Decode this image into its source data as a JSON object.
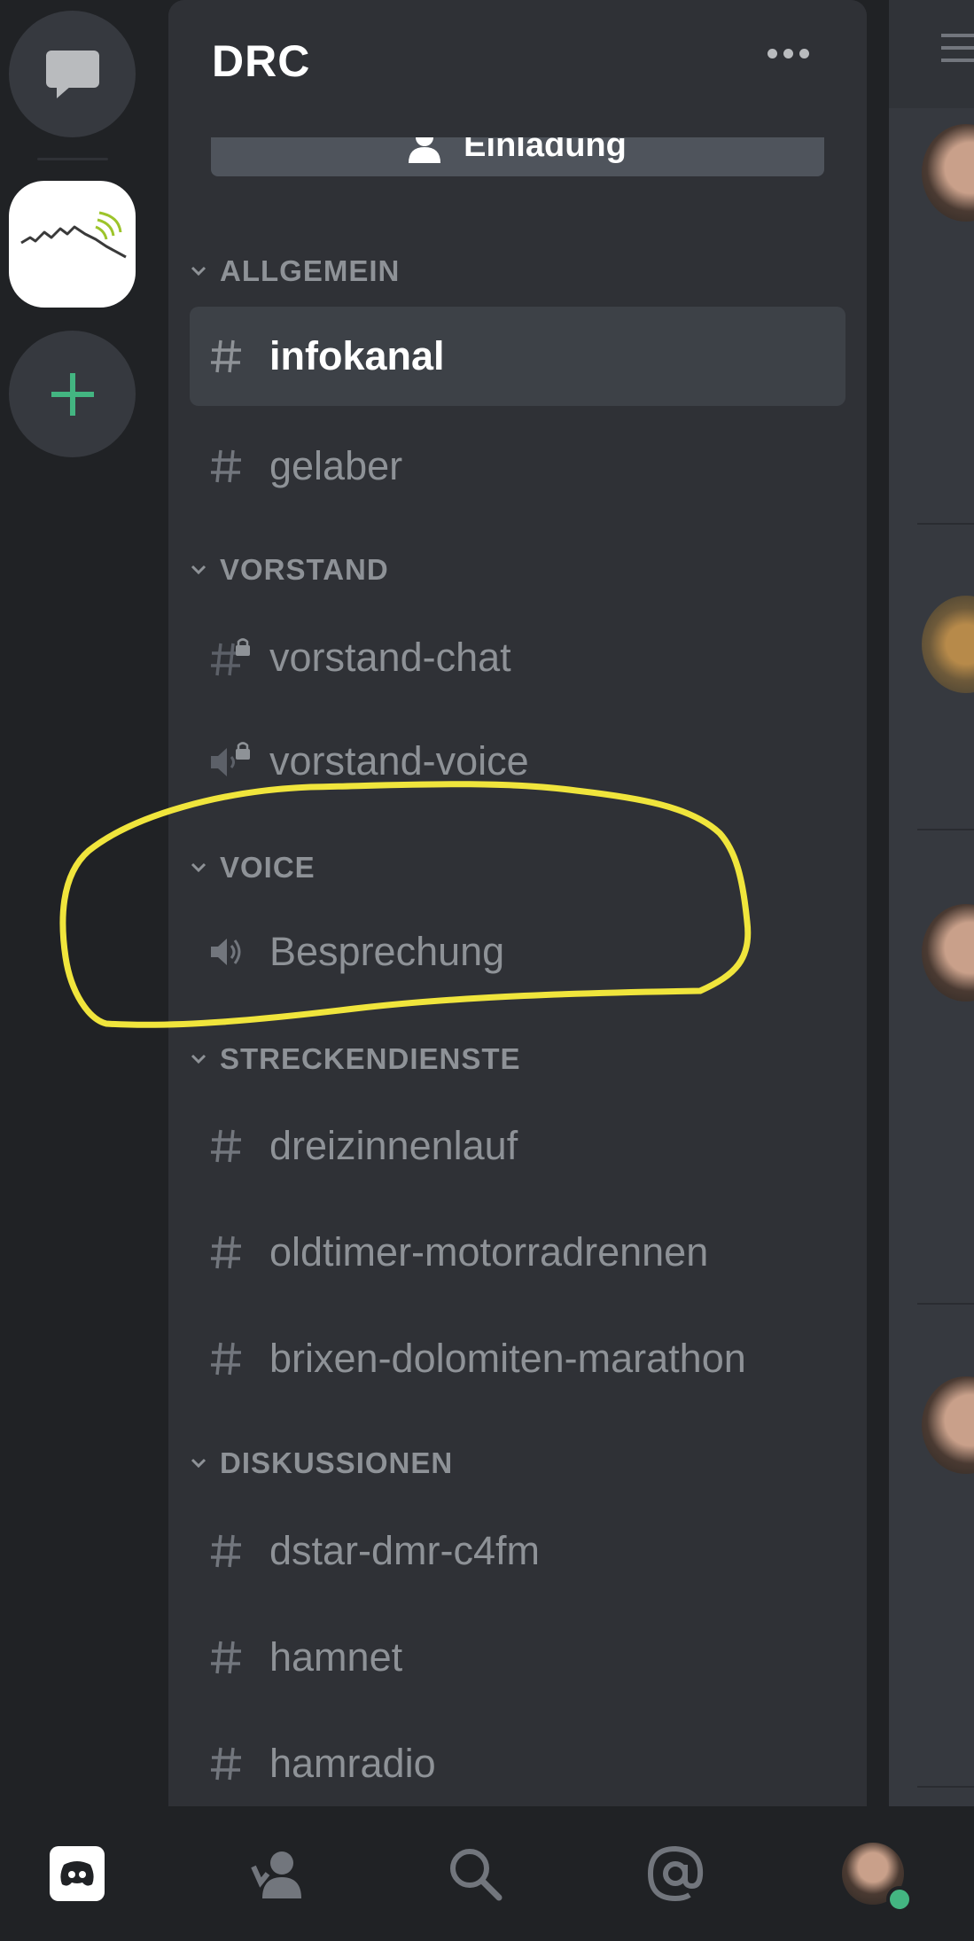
{
  "server": {
    "name": "DRC",
    "invite_label": "Einladung"
  },
  "categories": [
    {
      "label": "ALLGEMEIN"
    },
    {
      "label": "VORSTAND"
    },
    {
      "label": "VOICE"
    },
    {
      "label": "STRECKENDIENSTE"
    },
    {
      "label": "DISKUSSIONEN"
    }
  ],
  "channels": [
    {
      "label": "infokanal",
      "type": "text",
      "selected": true
    },
    {
      "label": "gelaber",
      "type": "text"
    },
    {
      "label": "vorstand-chat",
      "type": "text-locked"
    },
    {
      "label": "vorstand-voice",
      "type": "voice-locked"
    },
    {
      "label": "Besprechung",
      "type": "voice"
    },
    {
      "label": "dreizinnenlauf",
      "type": "text"
    },
    {
      "label": "oldtimer-motorradrennen",
      "type": "text"
    },
    {
      "label": "brixen-dolomiten-marathon",
      "type": "text"
    },
    {
      "label": "dstar-dmr-c4fm",
      "type": "text"
    },
    {
      "label": "hamnet",
      "type": "text"
    },
    {
      "label": "hamradio",
      "type": "text"
    }
  ],
  "rail": [
    "direct-messages-icon",
    "drc-server-icon",
    "add-server-icon"
  ],
  "bottom_nav": [
    "home-icon",
    "friends-icon",
    "search-icon",
    "mentions-icon",
    "profile-avatar"
  ],
  "colors": {
    "background": "#202225",
    "panel": "#2f3136",
    "selected": "#3d4147",
    "muted_text": "#8e9297",
    "add_green": "#43b581",
    "highlight": "#f0e53c",
    "online": "#43b581"
  }
}
